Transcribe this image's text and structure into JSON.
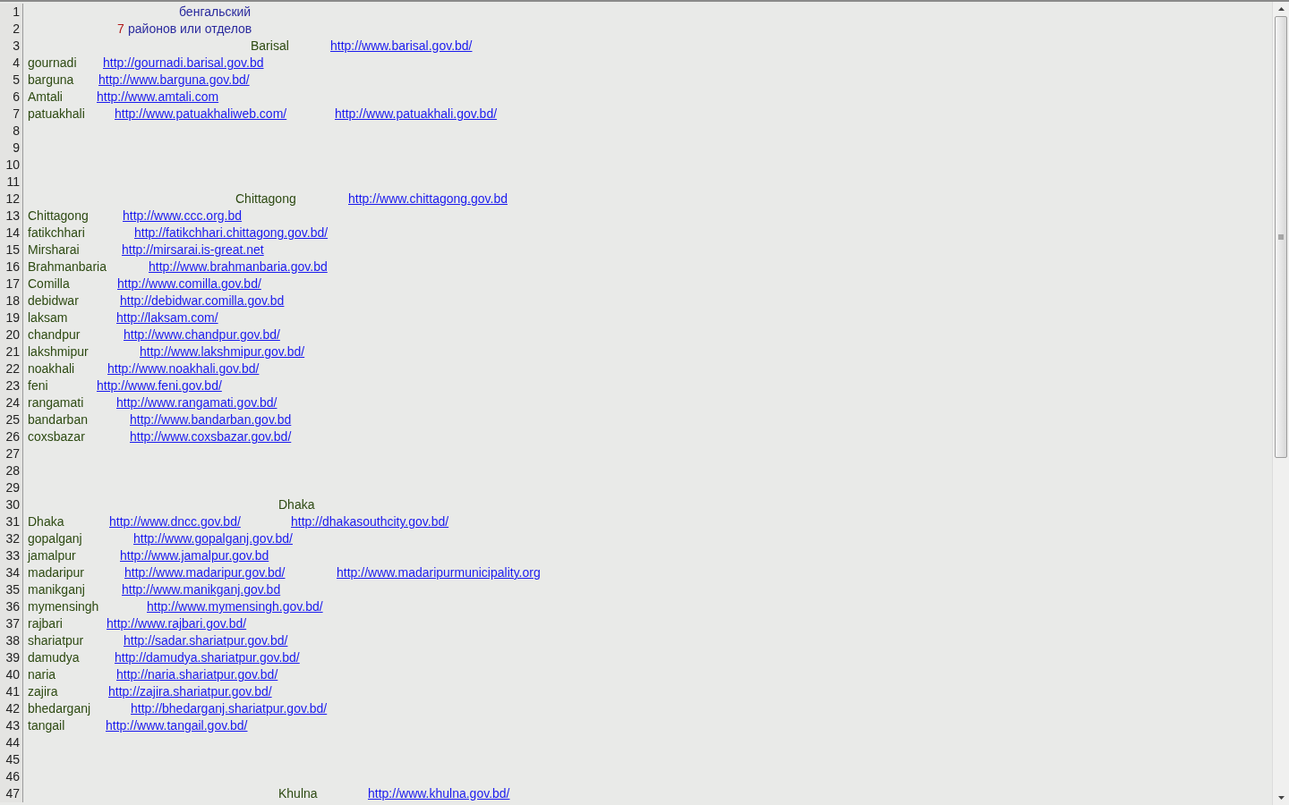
{
  "lines": [
    {
      "number": "1",
      "segments": [
        {
          "kind": "heading",
          "text": "бенгальский"
        }
      ]
    },
    {
      "number": "2",
      "segments": [
        {
          "kind": "number",
          "text": "7"
        },
        {
          "kind": "heading",
          "text": "районов или отделов"
        }
      ]
    },
    {
      "number": "3",
      "segments": [
        {
          "kind": "name",
          "text": "Barisal"
        },
        {
          "kind": "link",
          "text": "http://www.barisal.gov.bd/"
        }
      ]
    },
    {
      "number": "4",
      "segments": [
        {
          "kind": "name",
          "text": "gournadi"
        },
        {
          "kind": "link",
          "text": "http://gournadi.barisal.gov.bd"
        }
      ]
    },
    {
      "number": "5",
      "segments": [
        {
          "kind": "name",
          "text": "barguna"
        },
        {
          "kind": "link",
          "text": "http://www.barguna.gov.bd/"
        }
      ]
    },
    {
      "number": "6",
      "segments": [
        {
          "kind": "name",
          "text": "Amtali"
        },
        {
          "kind": "link",
          "text": "http://www.amtali.com"
        }
      ]
    },
    {
      "number": "7",
      "segments": [
        {
          "kind": "name",
          "text": "patuakhali"
        },
        {
          "kind": "link",
          "text": "http://www.patuakhaliweb.com/"
        },
        {
          "kind": "link",
          "text": "http://www.patuakhali.gov.bd/"
        }
      ]
    },
    {
      "number": "8"
    },
    {
      "number": "9"
    },
    {
      "number": "10"
    },
    {
      "number": "11"
    },
    {
      "number": "12",
      "segments": [
        {
          "kind": "name",
          "text": "Chittagong"
        },
        {
          "kind": "link",
          "text": "http://www.chittagong.gov.bd"
        }
      ]
    },
    {
      "number": "13",
      "segments": [
        {
          "kind": "name",
          "text": "Chittagong"
        },
        {
          "kind": "link",
          "text": "http://www.ccc.org.bd"
        }
      ]
    },
    {
      "number": "14",
      "segments": [
        {
          "kind": "name",
          "text": "fatikchhari"
        },
        {
          "kind": "link",
          "text": "http://fatikchhari.chittagong.gov.bd/"
        }
      ]
    },
    {
      "number": "15",
      "segments": [
        {
          "kind": "name",
          "text": "Mirsharai"
        },
        {
          "kind": "link",
          "text": "http://mirsarai.is-great.net"
        }
      ]
    },
    {
      "number": "16",
      "segments": [
        {
          "kind": "name",
          "text": "Brahmanbaria"
        },
        {
          "kind": "link",
          "text": "http://www.brahmanbaria.gov.bd"
        }
      ]
    },
    {
      "number": "17",
      "segments": [
        {
          "kind": "name",
          "text": "Comilla"
        },
        {
          "kind": "link",
          "text": "http://www.comilla.gov.bd/"
        }
      ]
    },
    {
      "number": "18",
      "segments": [
        {
          "kind": "name",
          "text": "debidwar"
        },
        {
          "kind": "link",
          "text": "http://debidwar.comilla.gov.bd"
        }
      ]
    },
    {
      "number": "19",
      "segments": [
        {
          "kind": "name",
          "text": "laksam"
        },
        {
          "kind": "link",
          "text": "http://laksam.com/"
        }
      ]
    },
    {
      "number": "20",
      "segments": [
        {
          "kind": "name",
          "text": "chandpur"
        },
        {
          "kind": "link",
          "text": "http://www.chandpur.gov.bd/"
        }
      ]
    },
    {
      "number": "21",
      "segments": [
        {
          "kind": "name",
          "text": "lakshmipur"
        },
        {
          "kind": "link",
          "text": "http://www.lakshmipur.gov.bd/"
        }
      ]
    },
    {
      "number": "22",
      "segments": [
        {
          "kind": "name",
          "text": "noakhali"
        },
        {
          "kind": "link",
          "text": "http://www.noakhali.gov.bd/"
        }
      ]
    },
    {
      "number": "23",
      "segments": [
        {
          "kind": "name",
          "text": "feni"
        },
        {
          "kind": "link",
          "text": "http://www.feni.gov.bd/"
        }
      ]
    },
    {
      "number": "24",
      "segments": [
        {
          "kind": "name",
          "text": "rangamati"
        },
        {
          "kind": "link",
          "text": "http://www.rangamati.gov.bd/"
        }
      ]
    },
    {
      "number": "25",
      "segments": [
        {
          "kind": "name",
          "text": "bandarban"
        },
        {
          "kind": "link",
          "text": "http://www.bandarban.gov.bd"
        }
      ]
    },
    {
      "number": "26",
      "segments": [
        {
          "kind": "name",
          "text": "coxsbazar"
        },
        {
          "kind": "link",
          "text": "http://www.coxsbazar.gov.bd/"
        }
      ]
    },
    {
      "number": "27"
    },
    {
      "number": "28"
    },
    {
      "number": "29"
    },
    {
      "number": "30",
      "segments": [
        {
          "kind": "name",
          "text": "Dhaka"
        }
      ]
    },
    {
      "number": "31",
      "segments": [
        {
          "kind": "name",
          "text": "Dhaka"
        },
        {
          "kind": "link",
          "text": "http://www.dncc.gov.bd/"
        },
        {
          "kind": "link",
          "text": "http://dhakasouthcity.gov.bd/"
        }
      ]
    },
    {
      "number": "32",
      "segments": [
        {
          "kind": "name",
          "text": "gopalganj"
        },
        {
          "kind": "link",
          "text": "http://www.gopalganj.gov.bd/"
        }
      ]
    },
    {
      "number": "33",
      "segments": [
        {
          "kind": "name",
          "text": "jamalpur"
        },
        {
          "kind": "link",
          "text": "http://www.jamalpur.gov.bd"
        }
      ]
    },
    {
      "number": "34",
      "segments": [
        {
          "kind": "name",
          "text": "madaripur"
        },
        {
          "kind": "link",
          "text": "http://www.madaripur.gov.bd/"
        },
        {
          "kind": "link",
          "text": "http://www.madaripurmunicipality.org"
        }
      ]
    },
    {
      "number": "35",
      "segments": [
        {
          "kind": "name",
          "text": "manikganj"
        },
        {
          "kind": "link",
          "text": "http://www.manikganj.gov.bd"
        }
      ]
    },
    {
      "number": "36",
      "segments": [
        {
          "kind": "name",
          "text": "mymensingh"
        },
        {
          "kind": "link",
          "text": "http://www.mymensingh.gov.bd/"
        }
      ]
    },
    {
      "number": "37",
      "segments": [
        {
          "kind": "name",
          "text": "rajbari"
        },
        {
          "kind": "link",
          "text": "http://www.rajbari.gov.bd/"
        }
      ]
    },
    {
      "number": "38",
      "segments": [
        {
          "kind": "name",
          "text": "shariatpur"
        },
        {
          "kind": "link",
          "text": "http://sadar.shariatpur.gov.bd/"
        }
      ]
    },
    {
      "number": "39",
      "segments": [
        {
          "kind": "name",
          "text": "damudya"
        },
        {
          "kind": "link",
          "text": "http://damudya.shariatpur.gov.bd/"
        }
      ]
    },
    {
      "number": "40",
      "segments": [
        {
          "kind": "name",
          "text": "naria"
        },
        {
          "kind": "link",
          "text": "http://naria.shariatpur.gov.bd/"
        }
      ]
    },
    {
      "number": "41",
      "segments": [
        {
          "kind": "name",
          "text": "zajira"
        },
        {
          "kind": "link",
          "text": "http://zajira.shariatpur.gov.bd/"
        }
      ]
    },
    {
      "number": "42",
      "segments": [
        {
          "kind": "name",
          "text": "bhedarganj"
        },
        {
          "kind": "link",
          "text": "http://bhedarganj.shariatpur.gov.bd/"
        }
      ]
    },
    {
      "number": "43",
      "segments": [
        {
          "kind": "name",
          "text": "tangail"
        },
        {
          "kind": "link",
          "text": "http://www.tangail.gov.bd/"
        }
      ]
    },
    {
      "number": "44"
    },
    {
      "number": "45"
    },
    {
      "number": "46"
    },
    {
      "number": "47",
      "segments": [
        {
          "kind": "name",
          "text": "Khulna"
        },
        {
          "kind": "link",
          "text": "http://www.khulna.gov.bd/"
        }
      ]
    }
  ]
}
